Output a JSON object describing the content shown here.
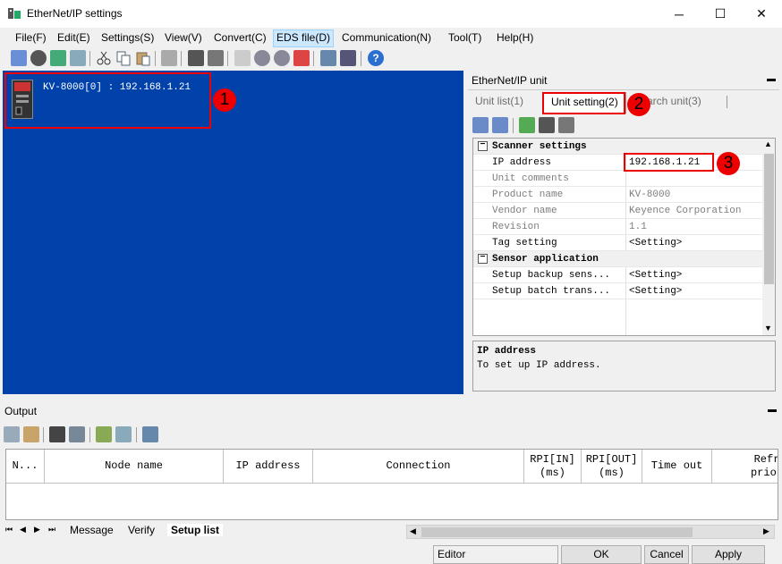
{
  "window": {
    "title": "EtherNet/IP settings",
    "minimize": "─",
    "maximize": "☐",
    "close": "✕"
  },
  "menu": [
    "File(F)",
    "Edit(E)",
    "Settings(S)",
    "View(V)",
    "Convert(C)",
    "EDS file(D)",
    "Communication(N)",
    "Tool(T)",
    "Help(H)"
  ],
  "canvas": {
    "node_label": "KV-8000[0] : 192.168.1.21"
  },
  "callouts": [
    "1",
    "2",
    "3"
  ],
  "right_panel": {
    "title": "EtherNet/IP unit",
    "pin": "ꟷ",
    "tabs": [
      "Unit list(1)",
      "Unit setting(2)",
      "arch unit(3)"
    ],
    "properties": [
      {
        "type": "category",
        "name": "Scanner settings",
        "toggle": "−"
      },
      {
        "name": "IP address",
        "value": "192.168.1.21",
        "enabled": true
      },
      {
        "name": "Unit comments",
        "value": "",
        "enabled": false
      },
      {
        "name": "Product name",
        "value": "KV-8000",
        "enabled": false
      },
      {
        "name": "Vendor name",
        "value": "Keyence Corporation",
        "enabled": false
      },
      {
        "name": "Revision",
        "value": "1.1",
        "enabled": false
      },
      {
        "name": "Tag setting",
        "value": "<Setting>",
        "enabled": true
      },
      {
        "type": "category",
        "name": "Sensor application",
        "toggle": "−"
      },
      {
        "name": "Setup backup sens...",
        "value": "<Setting>",
        "enabled": true
      },
      {
        "name": "Setup batch trans...",
        "value": "<Setting>",
        "enabled": true
      }
    ],
    "description": {
      "title": "IP address",
      "text": "To set up IP address."
    }
  },
  "output": {
    "title": "Output",
    "columns": [
      "N...",
      "Node name",
      "IP address",
      "Connection",
      "RPI[IN]\n(ms)",
      "RPI[OUT]\n(ms)",
      "Time out",
      "Refr\nprior"
    ],
    "tabs": [
      "Message",
      "Verify",
      "Setup list"
    ]
  },
  "status": {
    "mode": "Editor",
    "ok": "OK",
    "cancel": "Cancel",
    "apply": "Apply"
  },
  "colors": {
    "canvas_bg": "#0042aa",
    "highlight": "#ee0000"
  }
}
